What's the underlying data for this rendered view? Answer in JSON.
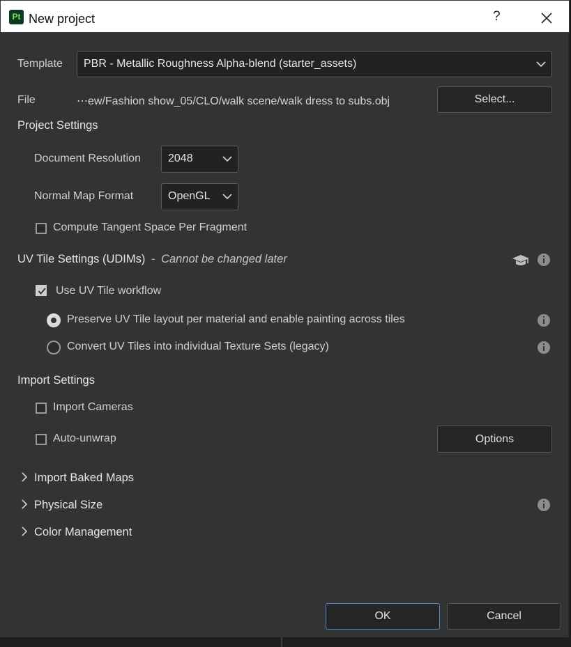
{
  "window": {
    "title": "New project",
    "icon_text": "Pt",
    "help_glyph": "?"
  },
  "template": {
    "label": "Template",
    "value": "PBR - Metallic Roughness Alpha-blend (starter_assets)"
  },
  "file": {
    "label": "File",
    "path": "⋯ew/Fashion show_05/CLO/walk scene/walk dress to subs.obj",
    "select_label": "Select..."
  },
  "project_settings": {
    "header": "Project Settings",
    "resolution_label": "Document Resolution",
    "resolution_value": "2048",
    "normal_label": "Normal Map Format",
    "normal_value": "OpenGL",
    "tangent_label": "Compute Tangent Space Per Fragment",
    "tangent_checked": false
  },
  "uv_tile": {
    "header": "UV Tile Settings (UDIMs)",
    "dash": "-",
    "note": "Cannot be changed later",
    "use_label": "Use UV Tile workflow",
    "use_checked": true,
    "option1": "Preserve UV Tile layout per material and enable painting across tiles",
    "option2": "Convert UV Tiles into individual Texture Sets (legacy)",
    "selected_option": 1
  },
  "import_settings": {
    "header": "Import Settings",
    "cameras_label": "Import Cameras",
    "cameras_checked": false,
    "unwrap_label": "Auto-unwrap",
    "unwrap_checked": false,
    "options_label": "Options"
  },
  "sections": {
    "baked": "Import Baked Maps",
    "physical": "Physical Size",
    "color": "Color Management"
  },
  "buttons": {
    "ok": "OK",
    "cancel": "Cancel"
  },
  "colors": {
    "dialog_bg": "#333333",
    "field_bg": "#222222",
    "accent_border": "#4d88c8",
    "app_icon_bg": "#0b3a1e",
    "app_icon_fg": "#7ce35e"
  }
}
